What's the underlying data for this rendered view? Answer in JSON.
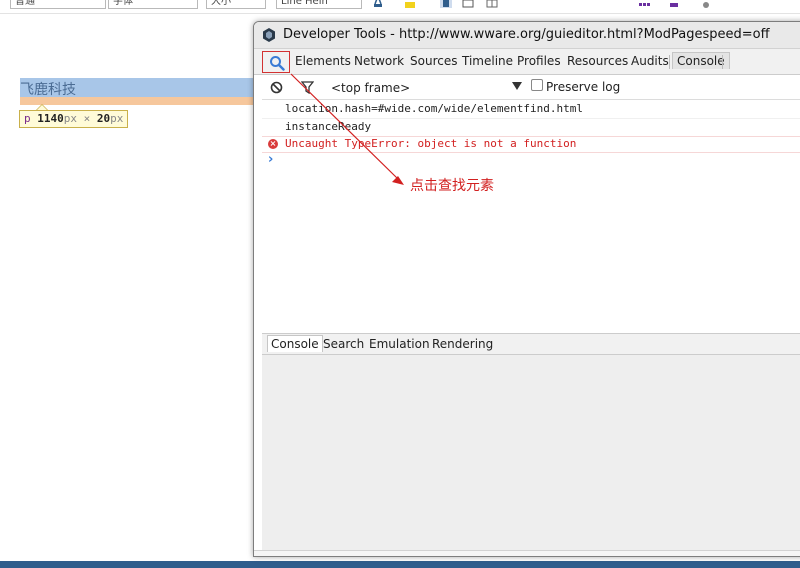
{
  "background_page": {
    "toolbar_fields": [
      "普通",
      "字体",
      "大小",
      "Line Heih"
    ],
    "highlighted_text": "飞鹿科技",
    "dimension_tooltip": {
      "tag": "p",
      "width": "1140",
      "height": "20",
      "unit": "px",
      "separator": "×"
    }
  },
  "devtools": {
    "title": "Developer Tools - http://www.wware.org/guieditor.html?ModPagespeed=off",
    "tabs": [
      "Elements",
      "Network",
      "Sources",
      "Timeline",
      "Profiles",
      "Resources",
      "Audits",
      "Console"
    ],
    "active_tab": "Console",
    "console_toolbar": {
      "frame": "<top frame>",
      "preserve_log_label": "Preserve log",
      "preserve_log_checked": false
    },
    "console_lines": [
      {
        "text": "location.hash=#wide.com/wide/elementfind.html",
        "level": "log"
      },
      {
        "text": "instanceReady",
        "level": "log"
      },
      {
        "text": "Uncaught TypeError: object is not a function",
        "level": "error"
      }
    ],
    "drawer_tabs": [
      "Console",
      "Search",
      "Emulation",
      "Rendering"
    ],
    "active_drawer_tab": "Console"
  },
  "annotation": {
    "text": "点击查找元素",
    "color": "#d22020"
  },
  "colors": {
    "highlight": "#a8c6e8",
    "padding": "#f6c79c",
    "error": "#d22020",
    "prompt": "#3a7bd5"
  },
  "icons": {
    "inspect": "magnifier-icon",
    "clear": "clear-console-icon",
    "filter": "filter-icon",
    "app": "devtools-app-icon"
  }
}
